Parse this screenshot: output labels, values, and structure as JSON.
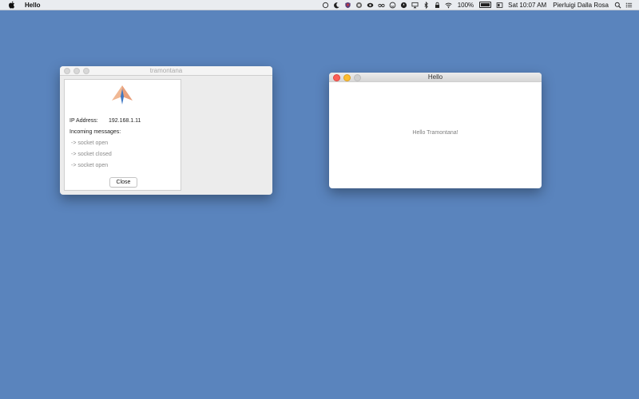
{
  "menubar": {
    "app_name": "Hello",
    "battery_percent": "100%",
    "clock": "Sat 10:07 AM",
    "user": "Pierluigi Dalla Rosa",
    "status_icons": [
      "circle-icon",
      "moon-icon",
      "shield-icon",
      "vpn-icon",
      "eye-icon",
      "glasses-icon",
      "smiley-icon",
      "compass-icon",
      "airplay-icon",
      "bluetooth-icon",
      "lock-icon",
      "wifi-icon",
      "battery-icon",
      "display-icon",
      "spotlight-icon",
      "list-icon"
    ]
  },
  "window_tramontana": {
    "title": "tramontana",
    "ip_label": "IP Address:",
    "ip_value": "192.168.1.11",
    "incoming_label": "Incoming messages:",
    "messages": [
      "-> socket open",
      "-> socket closed",
      "-> socket open"
    ],
    "close_label": "Close"
  },
  "window_hello": {
    "title": "Hello",
    "message": "Hello Tramontana!"
  },
  "colors": {
    "desktop": "#5a84bd",
    "close_red": "#fc5f57",
    "minimize_yellow": "#fdbc2e",
    "zoom_gray": "#cfcfcf",
    "logo_orange": "#e9a07c",
    "logo_blue": "#3f78c4"
  }
}
